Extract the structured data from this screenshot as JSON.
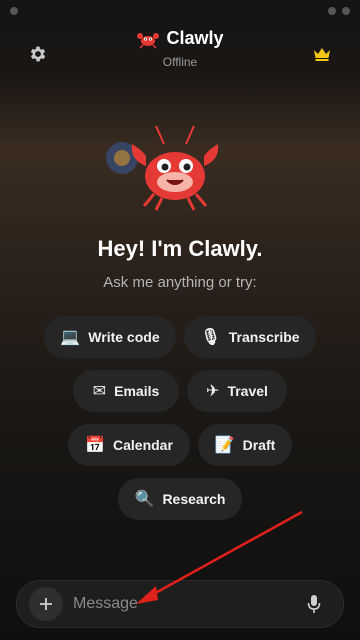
{
  "header": {
    "title": "Clawly",
    "status": "Offline",
    "icons": {
      "settings": "gear-icon",
      "upgrade": "crown-icon",
      "logo": "crab-icon"
    }
  },
  "hero": {
    "greeting": "Hey! I'm Clawly.",
    "subtitle": "Ask me anything or try:"
  },
  "suggestions": [
    {
      "emoji": "💻",
      "label": "Write code"
    },
    {
      "emoji": "🎙",
      "label": "Transcribe"
    },
    {
      "emoji": "✉",
      "label": "Emails"
    },
    {
      "emoji": "✈",
      "label": "Travel"
    },
    {
      "emoji": "📅",
      "label": "Calendar"
    },
    {
      "emoji": "📝",
      "label": "Draft"
    },
    {
      "emoji": "🔍",
      "label": "Research"
    }
  ],
  "composer": {
    "placeholder": "Message",
    "value": "",
    "icons": {
      "attach": "plus-icon",
      "voice": "microphone-icon"
    }
  },
  "colors": {
    "accent_crown": "#f5c518",
    "crab_red": "#e53935",
    "annotation_arrow": "#e0201a"
  }
}
